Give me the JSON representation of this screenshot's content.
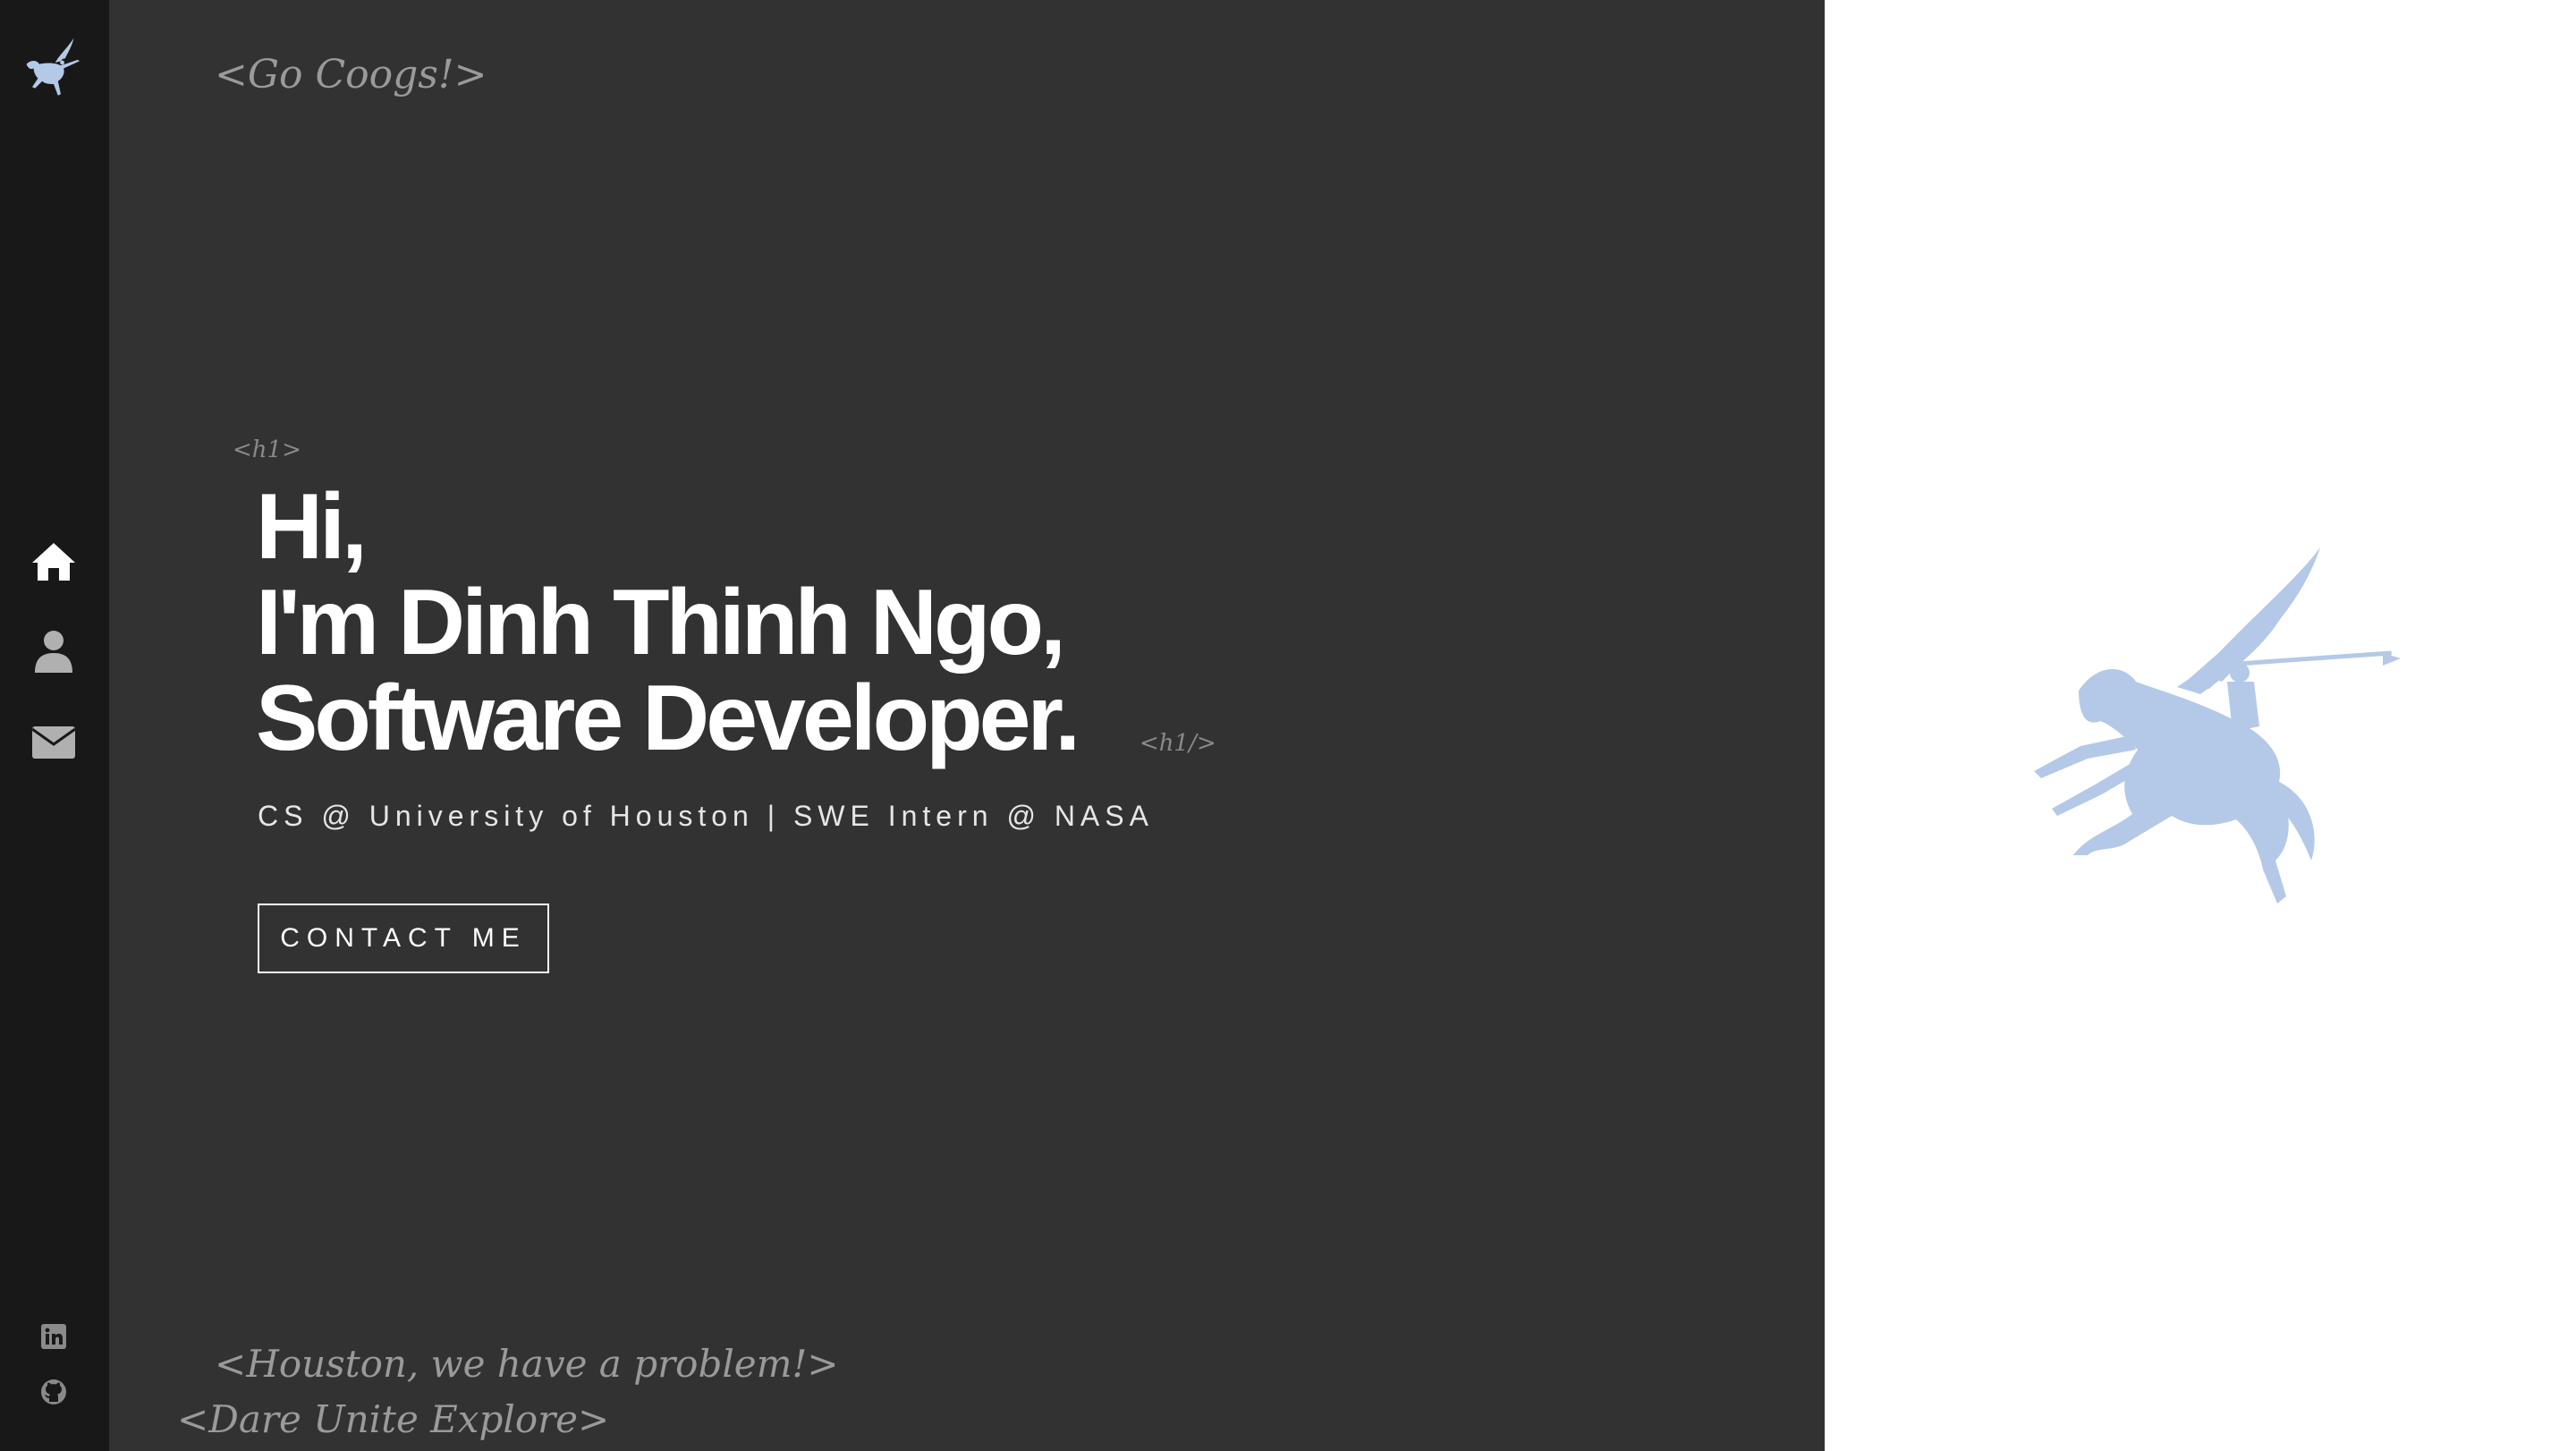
{
  "colors": {
    "sidebar_bg": "#181818",
    "main_bg": "#323232",
    "right_bg": "#ffffff",
    "accent": "#b4c9e8",
    "nav_active": "#ffffff",
    "nav_inactive": "#b0b0b0"
  },
  "sidebar": {
    "logo_icon": "pegasus-icon",
    "nav": [
      {
        "icon": "home-icon",
        "active": true
      },
      {
        "icon": "user-icon",
        "active": false
      },
      {
        "icon": "envelope-icon",
        "active": false
      }
    ],
    "social": [
      {
        "icon": "linkedin-icon"
      },
      {
        "icon": "github-icon"
      }
    ]
  },
  "decor": {
    "top_tag": "<Go Coogs!>",
    "h1_open": "<h1>",
    "h1_close": "<h1/>",
    "bottom_tag_1": "<Houston, we have a problem!>",
    "bottom_tag_2": "<Dare Unite Explore>"
  },
  "hero": {
    "line1": "Hi,",
    "line2": "I'm Dinh Thinh Ngo,",
    "line3": "Software Developer."
  },
  "subtitle": "CS @ University of Houston | SWE Intern @ NASA",
  "contact_button": "CONTACT ME",
  "illustration_icon": "pegasus-icon"
}
